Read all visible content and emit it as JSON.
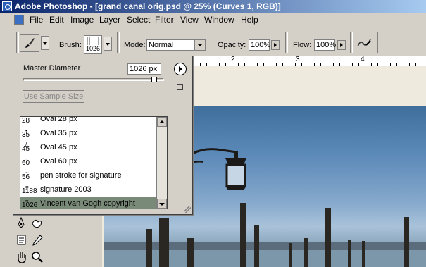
{
  "window": {
    "title": "Adobe Photoshop - [grand canal orig.psd @ 25% (Curves 1, RGB)]"
  },
  "menu": [
    "File",
    "Edit",
    "Image",
    "Layer",
    "Select",
    "Filter",
    "View",
    "Window",
    "Help"
  ],
  "options": {
    "brush_label": "Brush:",
    "brush_size": "1026",
    "mode_label": "Mode:",
    "mode_value": "Normal",
    "opacity_label": "Opacity:",
    "opacity_value": "100%",
    "flow_label": "Flow:",
    "flow_value": "100%"
  },
  "ruler": {
    "ticks": [
      "2",
      "3",
      "4"
    ]
  },
  "panel": {
    "master_diameter_label": "Master Diameter",
    "master_diameter_value": "1026 px",
    "slider_fraction": 0.93,
    "sample_button": "Use Sample Size",
    "brushes": [
      {
        "size": "28",
        "name": "Oval 28 px"
      },
      {
        "size": "35",
        "name": "Oval 35 px"
      },
      {
        "size": "45",
        "name": "Oval 45 px"
      },
      {
        "size": "60",
        "name": "Oval 60 px"
      },
      {
        "size": "56",
        "name": "pen stroke for signature"
      },
      {
        "size": "1188",
        "name": "signature 2003"
      },
      {
        "size": "1026",
        "name": "Vincent van Gogh copyright"
      }
    ],
    "selected_index": 6
  },
  "colors": {
    "title_start": "#0a246a",
    "title_end": "#a6caf0",
    "chrome": "#d4d0c8",
    "selected_row": "#7a8a78"
  }
}
